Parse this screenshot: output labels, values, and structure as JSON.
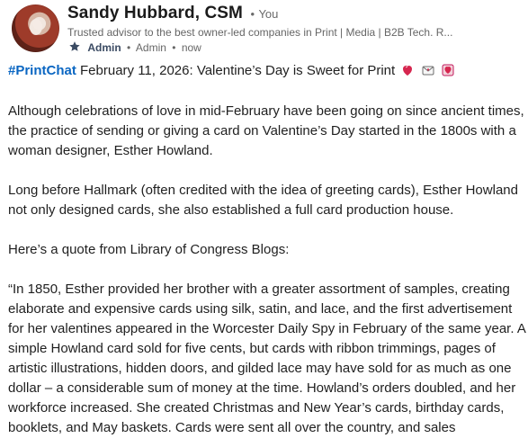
{
  "profile": {
    "name": "Sandy Hubbard, CSM",
    "separator": "•",
    "you_label": "You",
    "headline": "Trusted advisor to the best owner-led companies in Print | Media | B2B Tech. R...",
    "meta_role_strong": "Admin",
    "meta_role": "Admin",
    "meta_time": "now"
  },
  "post": {
    "hashtag": "#PrintChat",
    "title_rest": "February 11, 2026: Valentine’s Day is Sweet for Print",
    "emojis": [
      "heart-emoji",
      "envelope-emoji",
      "heart-box-emoji"
    ],
    "paragraphs": [
      "Although celebrations of love in mid-February have been going on since ancient times, the practice of sending or giving a card on Valentine’s Day started in the 1800s with a woman designer, Esther Howland.",
      "Long before Hallmark (often credited with the idea of greeting cards), Esther Howland not only designed cards, she also established a full card production house.",
      "Here’s a quote from Library of Congress Blogs:"
    ],
    "quote": "“In 1850, Esther provided her brother with a greater assortment of samples, creating elaborate and expensive cards using silk, satin, and lace, and the first advertisement for her valentines appeared in the Worcester Daily Spy in February of the same year. A simple Howland card sold for five cents, but cards with ribbon trimmings, pages of artistic illustrations, hidden doors, and gilded lace may have sold for as much as one dollar – a considerable sum of money at the time. Howland’s orders doubled, and her workforce increased. She created Christmas and New Year’s cards, birthday cards, booklets, and May baskets. Cards were sent all over the country, and sales"
  },
  "colors": {
    "link": "#0a66c2",
    "text": "#1f1f1f",
    "muted": "#666666",
    "heart": "#d6264f"
  }
}
